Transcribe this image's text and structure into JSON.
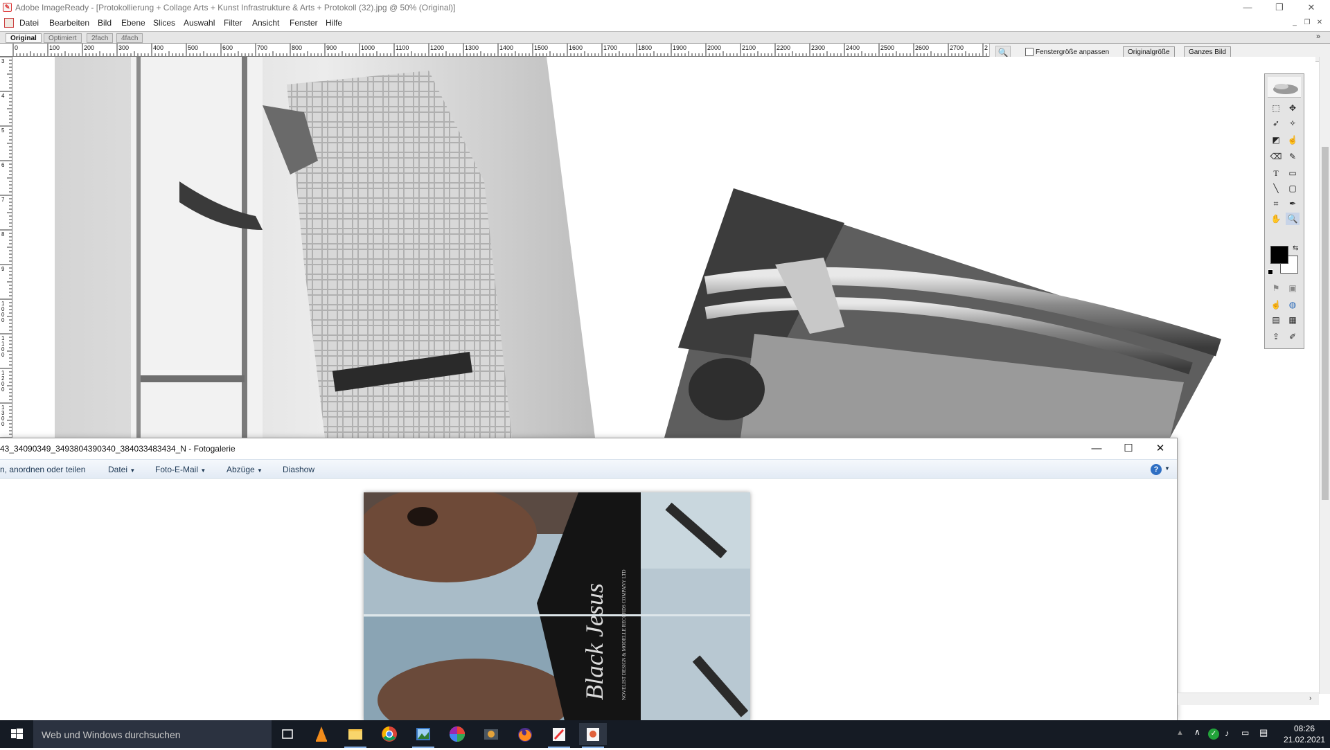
{
  "imageready": {
    "title": "Adobe ImageReady - [Protokollierung + Collage Arts + Kunst Infrastrukture & Arts + Protokoll (32).jpg @ 50% (Original)]",
    "menu": [
      "Datei",
      "Bearbeiten",
      "Bild",
      "Ebene",
      "Slices",
      "Auswahl",
      "Filter",
      "Ansicht",
      "Fenster",
      "Hilfe"
    ],
    "view_tabs": [
      "Original",
      "Optimiert",
      "2fach",
      "4fach"
    ],
    "active_tab": "Original",
    "ruler_labels": [
      "0",
      "100",
      "200",
      "300",
      "400",
      "500",
      "600",
      "700",
      "800",
      "900",
      "1000",
      "1100",
      "1200",
      "1300",
      "1400",
      "1500",
      "1600",
      "1700",
      "1800",
      "1900",
      "2000",
      "2100",
      "2200",
      "2300",
      "2400",
      "2500",
      "2600",
      "2700",
      "2"
    ],
    "vertical_ruler_labels": [
      "3",
      "4",
      "5",
      "6",
      "7",
      "8",
      "9",
      "1000",
      "1100",
      "1200",
      "1300",
      "1400"
    ],
    "zoombar": {
      "fit_window_label": "Fenstergröße anpassen",
      "fit_window_checked": false,
      "original_size_label": "Originalgröße",
      "whole_image_label": "Ganzes Bild"
    },
    "toolbox": {
      "foreground_color": "#000000",
      "background_color": "#ffffff",
      "type_tool_label": "T"
    }
  },
  "gallery": {
    "title": "43_34090349_3493804390340_384033483434_N - Fotogalerie",
    "toolbar": {
      "organize_label": "n, anordnen oder teilen",
      "file_label": "Datei",
      "email_label": "Foto-E-Mail",
      "prints_label": "Abzüge",
      "slideshow_label": "Diashow"
    },
    "photo_overlay_text": "Black Jesus",
    "photo_overlay_small": "NOVELIST DESIGN & MODELLE RECORDS COMPANY LTD"
  },
  "taskbar": {
    "search_placeholder": "Web und Windows durchsuchen",
    "time": "08:26",
    "date": "21.02.2021",
    "apps": [
      "task-view-icon",
      "vlc-icon",
      "file-explorer-icon",
      "chrome-icon",
      "photo-gallery-icon",
      "picasa-icon",
      "camera-icon",
      "firefox-icon",
      "imageready-icon",
      "photoshop-icon"
    ]
  }
}
